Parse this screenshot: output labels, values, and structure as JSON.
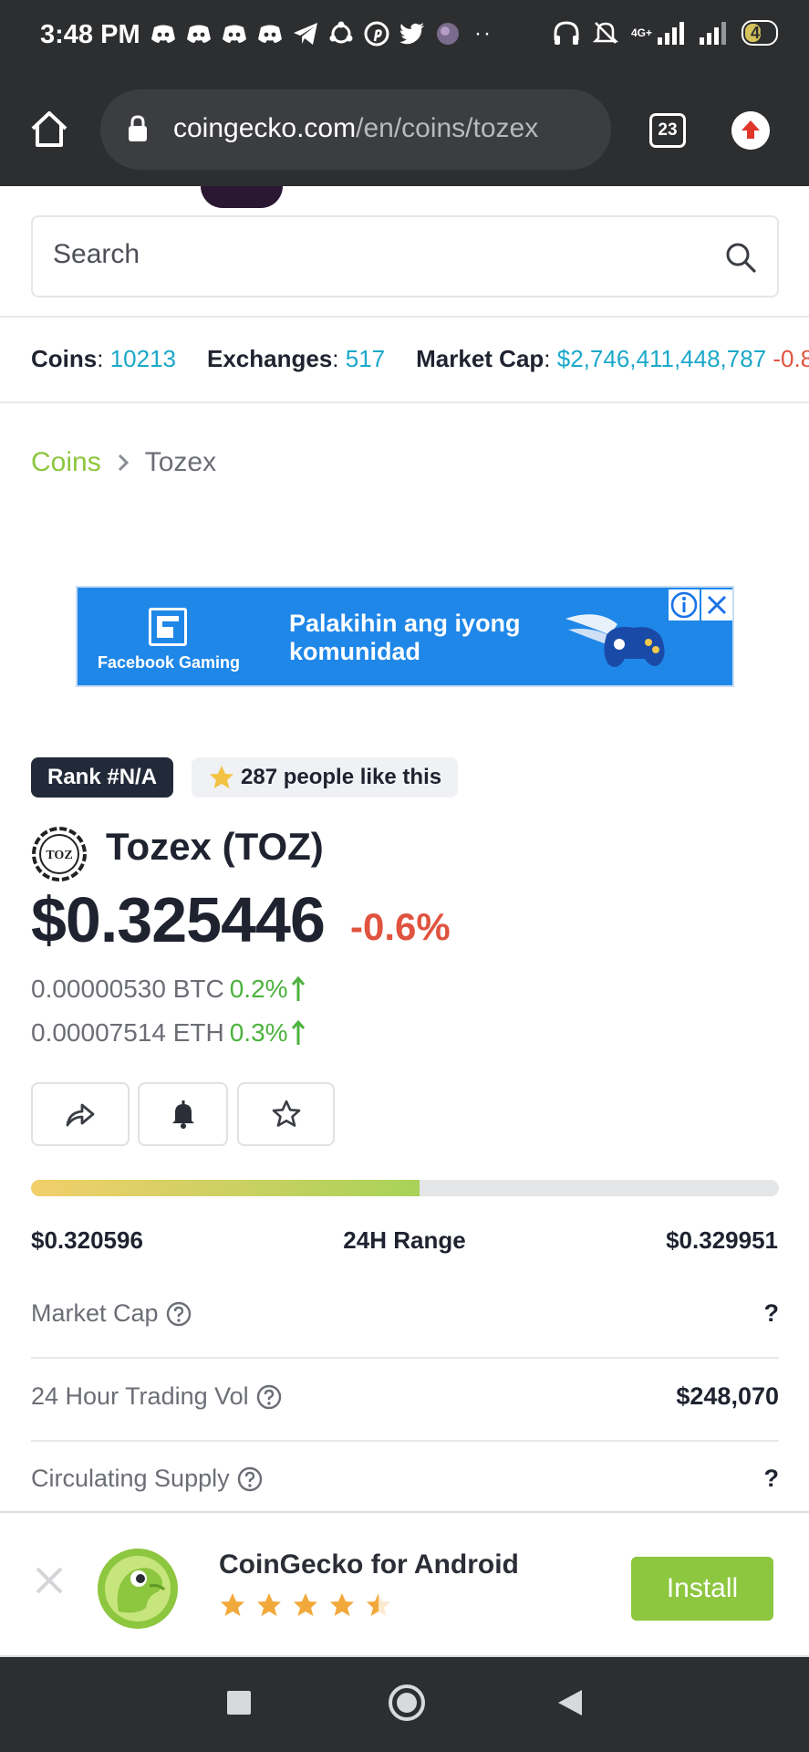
{
  "status_bar": {
    "time": "3:48 PM",
    "network": "4G+",
    "battery": "46"
  },
  "browser": {
    "url_domain": "coingecko.com",
    "url_path": "/en/coins/tozex",
    "tab_count": "23"
  },
  "search": {
    "placeholder": "Search"
  },
  "global_stats": {
    "coins_label": "Coins",
    "coins_value": "10213",
    "exchanges_label": "Exchanges",
    "exchanges_value": "517",
    "market_cap_label": "Market Cap",
    "market_cap_value": "$2,746,411,448,787",
    "market_cap_change": "-0.8"
  },
  "breadcrumb": {
    "root": "Coins",
    "current": "Tozex"
  },
  "ad": {
    "brand": "Facebook Gaming",
    "line1": "Palakihin ang iyong",
    "line2": "komunidad"
  },
  "coin": {
    "rank": "Rank #N/A",
    "likes": "287 people like this",
    "logo_text": "TOZ",
    "name": "Tozex (TOZ)",
    "price": "$0.325446",
    "price_change": "-0.6%",
    "btc_price": "0.00000530 BTC",
    "btc_change": "0.2%",
    "eth_price": "0.00007514 ETH",
    "eth_change": "0.3%"
  },
  "range_24h": {
    "low": "$0.320596",
    "label": "24H Range",
    "high": "$0.329951",
    "position_fraction": 0.52
  },
  "stats": [
    {
      "label": "Market Cap",
      "value": "?"
    },
    {
      "label": "24 Hour Trading Vol",
      "value": "$248,070"
    },
    {
      "label": "Circulating Supply",
      "value": "?"
    }
  ],
  "install_banner": {
    "app_name": "CoinGecko for Android",
    "rating": 4.5,
    "button_label": "Install"
  },
  "colors": {
    "brand_green": "#8dc63f",
    "link_teal": "#1ba8c9",
    "negative_red": "#e0533f",
    "positive_green": "#4cb23d",
    "dark_badge": "#222a3a"
  }
}
